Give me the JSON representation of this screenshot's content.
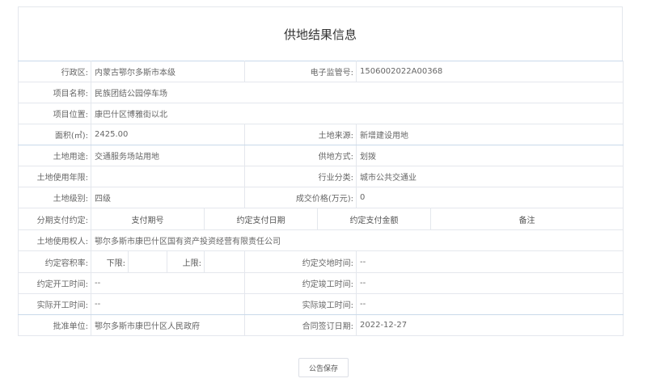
{
  "title": "供地结果信息",
  "rows": {
    "district_label": "行政区:",
    "district_value": "内蒙古鄂尔多斯市本级",
    "code_label": "电子监管号:",
    "code_value": "1506002022A00368",
    "project_name_label": "项目名称:",
    "project_name_value": "民族团结公园停车场",
    "location_label": "项目位置:",
    "location_value": "康巴什区博雅街以北",
    "area_label": "面积(㎡):",
    "area_value": "2425.00",
    "source_label": "土地来源:",
    "source_value": "新增建设用地",
    "usage_label": "土地用途:",
    "usage_value": "交通服务场站用地",
    "supply_label": "供地方式:",
    "supply_value": "划拨",
    "years_label": "土地使用年限:",
    "years_value": "",
    "industry_label": "行业分类:",
    "industry_value": "城市公共交通业",
    "level_label": "土地级别:",
    "level_value": "四级",
    "price_label": "成交价格(万元):",
    "price_value": "0",
    "installment_label": "分期支付约定:",
    "installment_cols": [
      "支付期号",
      "约定支付日期",
      "约定支付金额",
      "备注"
    ],
    "owner_label": "土地使用权人:",
    "owner_value": "鄂尔多斯市康巴什区国有资产投资经营有限责任公司",
    "plot_ratio_label": "约定容积率:",
    "lower_label": "下限:",
    "lower_value": "",
    "upper_label": "上限:",
    "upper_value": "",
    "delivery_label": "约定交地时间:",
    "delivery_value": "--",
    "start_label": "约定开工时间:",
    "start_value": "--",
    "complete_label": "约定竣工时间:",
    "complete_value": "--",
    "actual_start_label": "实际开工时间:",
    "actual_start_value": "--",
    "actual_complete_label": "实际竣工时间:",
    "actual_complete_value": "--",
    "approver_label": "批准单位:",
    "approver_value": "鄂尔多斯市康巴什区人民政府",
    "contract_date_label": "合同签订日期:",
    "contract_date_value": "2022-12-27"
  },
  "button_label": "公告保存"
}
